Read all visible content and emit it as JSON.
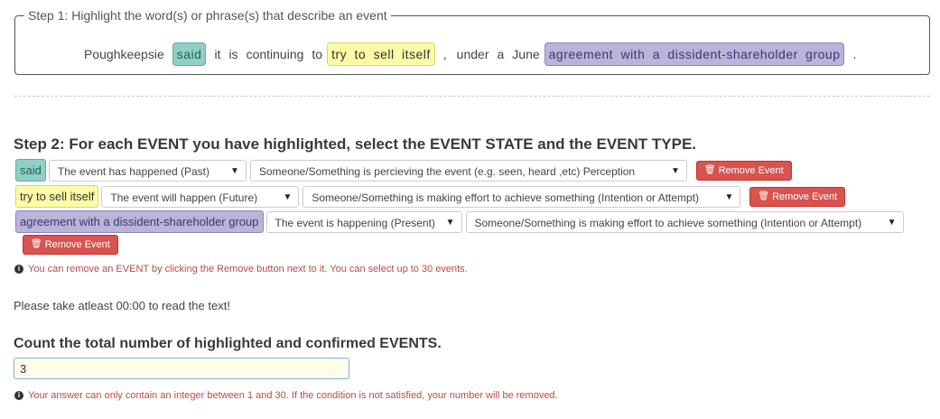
{
  "step1": {
    "legend": "Step 1: Highlight the word(s) or phrase(s) that describe an event",
    "sentence": {
      "w1": "Poughkeepsie",
      "hl1": "said",
      "w2": "it",
      "w3": "is",
      "w4": "continuing",
      "w5": "to",
      "hl2": "try to sell itself",
      "w6": ",",
      "w7": "under",
      "w8": "a",
      "w9": "June",
      "hl3": "agreement with a dissident-shareholder group",
      "w10": "."
    }
  },
  "step2": {
    "title": "Step 2: For each EVENT you have highlighted, select the EVENT STATE and the EVENT TYPE.",
    "events": [
      {
        "tag": "said",
        "state": "The event has happened (Past)",
        "type": "Someone/Something is percieving the event (e.g. seen, heard ,etc) Perception",
        "remove_label": "Remove Event",
        "color": "#8fd0c4"
      },
      {
        "tag": "try to sell itself",
        "state": "The event will happen (Future)",
        "type": "Someone/Something is making effort to achieve something (Intention or Attempt)",
        "remove_label": "Remove Event",
        "color": "#fdfca6"
      },
      {
        "tag": "agreement with a dissident-shareholder group",
        "state": "The event is happening (Present)",
        "type": "Someone/Something is making effort to achieve something (Intention or Attempt)",
        "remove_label": "Remove Event",
        "color": "#b9b4d8"
      }
    ],
    "remove_note": "You can remove an EVENT by clicking the Remove button next to it. You can select up to 30 events."
  },
  "read_notice": "Please take atleast 00:00 to read the text!",
  "count": {
    "title": "Count the total number of highlighted and confirmed EVENTS.",
    "value": "3",
    "note": "Your answer can only contain an integer between 1 and 30. If the condition is not satisfied, your number will be removed."
  },
  "icons": {
    "dropdown": "▼",
    "trash": "🗑",
    "info": "i"
  }
}
